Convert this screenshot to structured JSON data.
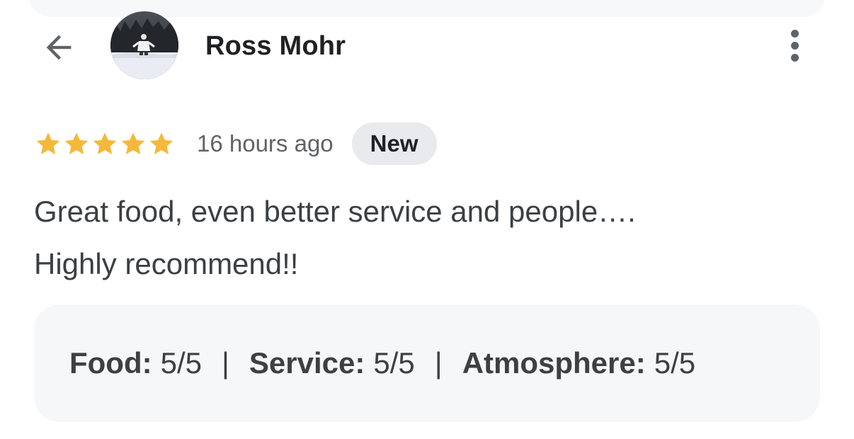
{
  "reviewer": {
    "name": "Ross Mohr",
    "avatar_alt": "Reviewer profile photo"
  },
  "icons": {
    "back": "arrow-back-icon",
    "more": "more-vert-icon",
    "star": "star-icon"
  },
  "review": {
    "rating": 5,
    "rating_max": 5,
    "time_ago": "16 hours ago",
    "badge": "New",
    "text_lines": [
      "Great food, even better service and people….",
      "Highly recommend!!"
    ]
  },
  "ratings": [
    {
      "label": "Food:",
      "value": "5/5"
    },
    {
      "label": "Service:",
      "value": "5/5"
    },
    {
      "label": "Atmosphere:",
      "value": "5/5"
    }
  ],
  "separator": "|",
  "colors": {
    "star": "#f4b93a",
    "icon": "#5f6368",
    "badge_bg": "#e8eaed",
    "panel_bg": "#f6f7f8"
  }
}
